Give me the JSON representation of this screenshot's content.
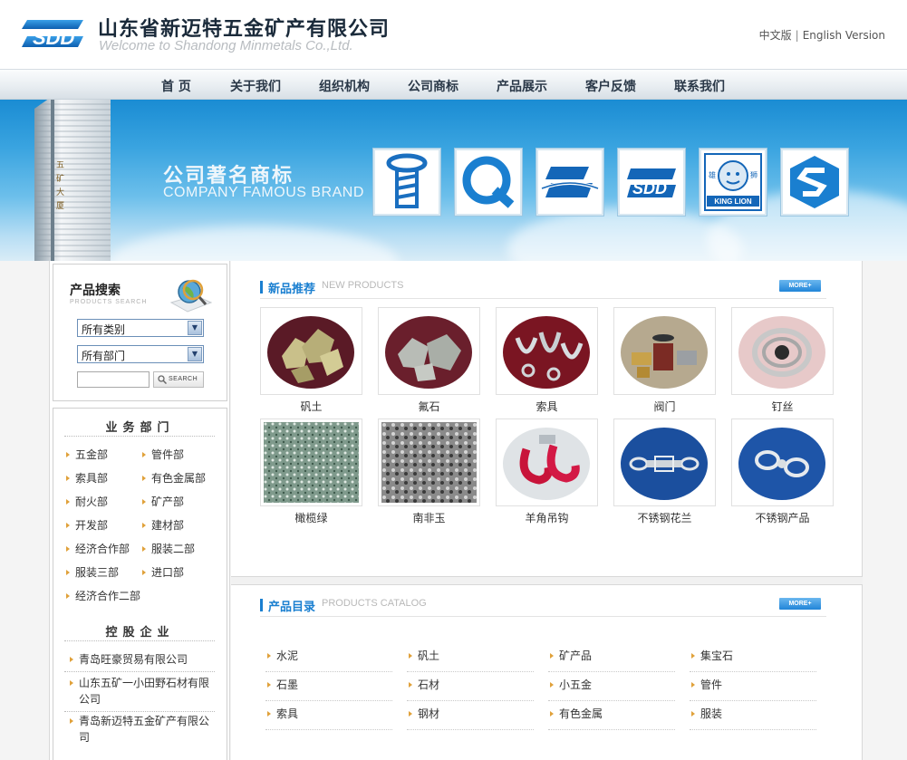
{
  "header": {
    "title": "山东省新迈特五金矿产有限公司",
    "subtitle": "Welcome to Shandong Minmetals Co.,Ltd.",
    "lang_cn": "中文版",
    "lang_sep": "|",
    "lang_en": "English Version"
  },
  "nav": [
    "首 页",
    "关于我们",
    "组织机构",
    "公司商标",
    "产品展示",
    "客户反馈",
    "联系我们"
  ],
  "banner": {
    "title": "公司著名商标",
    "subtitle": "COMPANY FAMOUS BRAND",
    "brands": [
      "screw-logo",
      "q-logo",
      "sdd-ribbon-logo",
      "sdd-logo",
      "king-lion-logo",
      "s-cube-logo"
    ],
    "king_lion_text": "KING LION",
    "king_lion_cn": [
      "雄",
      "狮"
    ],
    "tower_text": [
      "五",
      "矿",
      "大",
      "厦"
    ]
  },
  "search": {
    "title": "产品搜索",
    "title_en": "PRODUCTS SEARCH",
    "category_value": "所有类别",
    "department_value": "所有部门",
    "input_value": "",
    "button_label": "SEARCH"
  },
  "departments": {
    "heading": "业务部门",
    "items": [
      "五金部",
      "管件部",
      "索具部",
      "有色金属部",
      "耐火部",
      "矿产部",
      "开发部",
      "建材部",
      "经济合作部",
      "服装二部",
      "服装三部",
      "进口部",
      "经济合作二部"
    ]
  },
  "holdings": {
    "heading": "控股企业",
    "items": [
      "青岛旺豪贸易有限公司",
      "山东五矿一小田野石材有限公司",
      "青岛新迈特五金矿产有限公司"
    ]
  },
  "new_products": {
    "title": "新品推荐",
    "title_en": "NEW PRODUCTS",
    "more_label": "MORE+",
    "items": [
      "矾土",
      "氟石",
      "索具",
      "阀门",
      "钉丝",
      "橄榄绿",
      "南非玉",
      "羊角吊钩",
      "不锈钢花兰",
      "不锈钢产品"
    ]
  },
  "catalog": {
    "title": "产品目录",
    "title_en": "PRODUCTS CATALOG",
    "more_label": "MORE+",
    "items": [
      "水泥",
      "矾土",
      "矿产品",
      "集宝石",
      "石墨",
      "石材",
      "小五金",
      "管件",
      "索具",
      "钢材",
      "有色金属",
      "服装"
    ]
  },
  "colors": {
    "accent_blue": "#1a7fd0",
    "bullet_orange": "#e0a13a",
    "banner_blue": "#3aa4e0"
  }
}
